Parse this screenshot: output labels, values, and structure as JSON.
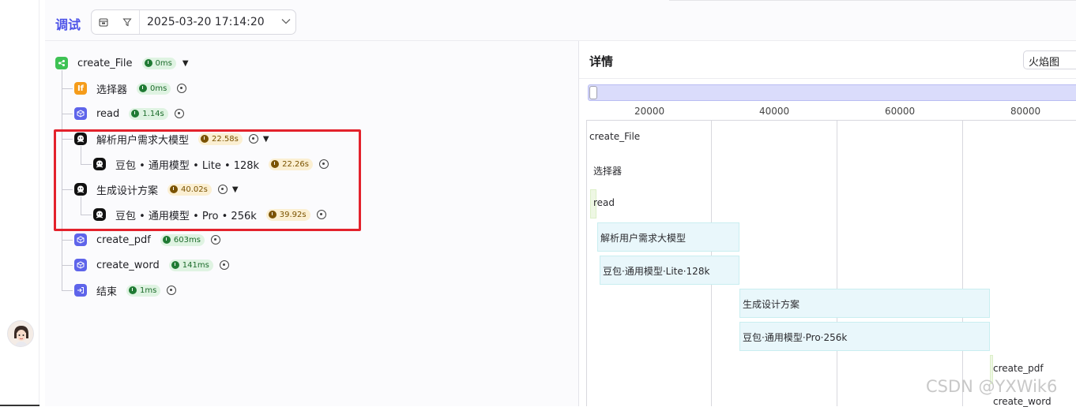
{
  "header": {
    "title": "调试",
    "datetime": "2025-03-20 17:14:20",
    "calendar_icon": "calendar-icon",
    "filter_icon": "filter-icon",
    "dropdown_icon": "chevron-down-icon"
  },
  "tree": {
    "nodes": [
      {
        "label": "create_File",
        "time": "0ms",
        "badge": "green",
        "icon": "start"
      },
      {
        "label": "选择器",
        "time": "0ms",
        "badge": "green",
        "icon": "if"
      },
      {
        "label": "read",
        "time": "1.14s",
        "badge": "green",
        "icon": "code"
      },
      {
        "label": "解析用户需求大模型",
        "time": "22.58s",
        "badge": "yellow",
        "icon": "llm"
      },
      {
        "label": "豆包 • 通用模型 • Lite • 128k",
        "time": "22.26s",
        "badge": "yellow",
        "icon": "llm"
      },
      {
        "label": "生成设计方案",
        "time": "40.02s",
        "badge": "yellow",
        "icon": "llm"
      },
      {
        "label": "豆包 • 通用模型 • Pro • 256k",
        "time": "39.92s",
        "badge": "yellow",
        "icon": "llm"
      },
      {
        "label": "create_pdf",
        "time": "603ms",
        "badge": "green",
        "icon": "code"
      },
      {
        "label": "create_word",
        "time": "141ms",
        "badge": "green",
        "icon": "code"
      },
      {
        "label": "结束",
        "time": "1ms",
        "badge": "green",
        "icon": "end"
      }
    ],
    "if_icon_text": "If"
  },
  "detail": {
    "title": "详情",
    "view_mode": "火焰图",
    "axis_ticks": [
      "20000",
      "40000",
      "60000",
      "80000"
    ],
    "flame": [
      {
        "label": "create_File"
      },
      {
        "label": "选择器"
      },
      {
        "label": "read"
      },
      {
        "label": "解析用户需求大模型"
      },
      {
        "label": "豆包·通用模型·Lite·128k"
      },
      {
        "label": "生成设计方案"
      },
      {
        "label": "豆包·通用模型·Pro·256k"
      },
      {
        "label": "create_pdf"
      },
      {
        "label": "create_word"
      }
    ]
  },
  "watermark": "CSDN @YXWik6"
}
